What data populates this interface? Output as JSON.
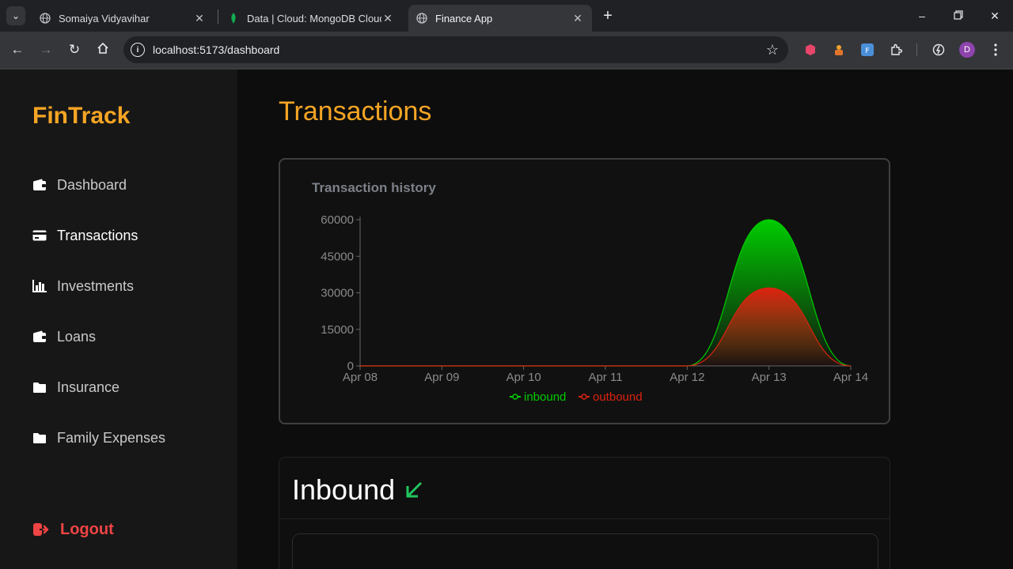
{
  "browser": {
    "tabs": [
      {
        "title": "Somaiya Vidyavihar",
        "active": false
      },
      {
        "title": "Data | Cloud: MongoDB Cloud",
        "active": false
      },
      {
        "title": "Finance App",
        "active": true
      }
    ],
    "url": "localhost:5173/dashboard",
    "profile_initial": "D"
  },
  "sidebar": {
    "brand": "FinTrack",
    "items": [
      {
        "label": "Dashboard",
        "icon": "wallet-icon"
      },
      {
        "label": "Transactions",
        "icon": "credit-card-icon",
        "active": true
      },
      {
        "label": "Investments",
        "icon": "bar-chart-icon"
      },
      {
        "label": "Loans",
        "icon": "wallet-icon"
      },
      {
        "label": "Insurance",
        "icon": "folder-icon"
      },
      {
        "label": "Family Expenses",
        "icon": "folder-icon"
      }
    ],
    "logout_label": "Logout"
  },
  "main": {
    "title": "Transactions",
    "inbound_heading": "Inbound"
  },
  "colors": {
    "accent": "#f5a524",
    "inbound": "#00cc00",
    "outbound": "#dd2211",
    "logout": "#ef4444"
  },
  "chart_data": {
    "type": "area",
    "title": "Transaction history",
    "categories": [
      "Apr 08",
      "Apr 09",
      "Apr 10",
      "Apr 11",
      "Apr 12",
      "Apr 13",
      "Apr 14"
    ],
    "series": [
      {
        "name": "inbound",
        "values": [
          0,
          0,
          0,
          0,
          0,
          60000,
          0
        ]
      },
      {
        "name": "outbound",
        "values": [
          0,
          0,
          0,
          0,
          0,
          32000,
          0
        ]
      }
    ],
    "yticks": [
      "0",
      "15000",
      "30000",
      "45000",
      "60000"
    ],
    "ylim": [
      0,
      60000
    ],
    "legend_position": "bottom-center"
  }
}
